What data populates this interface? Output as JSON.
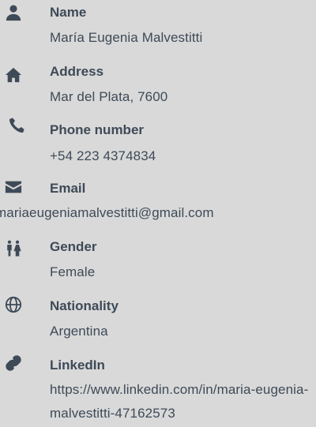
{
  "fields": [
    {
      "label": "Name",
      "value": "María Eugenia Malvestitti",
      "icon": "person-icon"
    },
    {
      "label": "Address",
      "value": "Mar del Plata, 7600",
      "icon": "home-icon"
    },
    {
      "label": "Phone  number",
      "value": "+54 223 4374834",
      "icon": "phone-icon"
    },
    {
      "label": "Email",
      "value": "mariaeugeniamalvestitti@gmail.com",
      "icon": "envelope-icon"
    },
    {
      "label": "Gender",
      "value": "Female",
      "icon": "gender-icon"
    },
    {
      "label": "Nationality",
      "value": "Argentina",
      "icon": "globe-icon"
    },
    {
      "label": "LinkedIn",
      "value": "https://www.linkedin.com/in/maria-eugenia-malvestitti-47162573",
      "icon": "link-icon"
    }
  ]
}
